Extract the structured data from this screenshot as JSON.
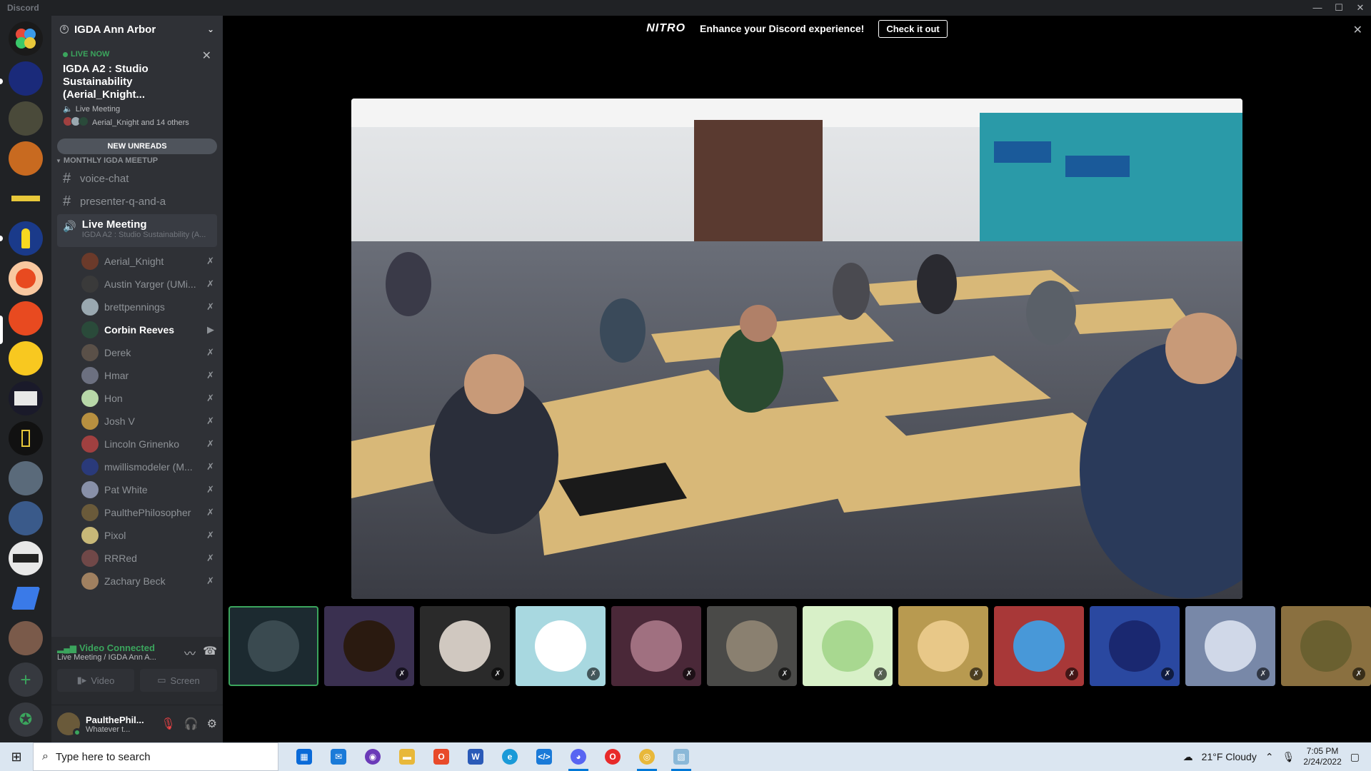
{
  "window": {
    "title": "Discord",
    "controls": [
      "—",
      "☐",
      "✕"
    ]
  },
  "nitro_banner": {
    "logo": "NITRO",
    "message": "Enhance your Discord experience!",
    "cta": "Check it out",
    "close": "✕"
  },
  "server": {
    "name": "IGDA Ann Arbor",
    "chevron": "⌄"
  },
  "live": {
    "badge": "LIVE NOW",
    "close": "✕",
    "title": "IGDA A2 : Studio Sustainability (Aerial_Knight...",
    "channel": "Live Meeting",
    "participants": "Aerial_Knight and 14 others"
  },
  "new_unreads": "NEW UNREADS",
  "category": "MONTHLY IGDA MEETUP",
  "channels": [
    {
      "name": "voice-chat"
    },
    {
      "name": "presenter-q-and-a"
    }
  ],
  "voice_channel": {
    "name": "Live Meeting",
    "sub": "IGDA A2 : Studio Sustainability (A..."
  },
  "voice_users": [
    {
      "name": "Aerial_Knight",
      "icon": "✗",
      "color": "#6b3a2a"
    },
    {
      "name": "Austin Yarger (UMi...",
      "icon": "✗",
      "color": "#3a3a3a"
    },
    {
      "name": "brettpennings",
      "icon": "✗",
      "color": "#9aa8b0"
    },
    {
      "name": "Corbin Reeves",
      "icon": "▶",
      "color": "#2a4a3a",
      "active": true
    },
    {
      "name": "Derek",
      "icon": "✗",
      "color": "#5a5048"
    },
    {
      "name": "Hmar",
      "icon": "✗",
      "color": "#6c7080"
    },
    {
      "name": "Hon",
      "icon": "✗",
      "color": "#b8d8a8"
    },
    {
      "name": "Josh V",
      "icon": "✗",
      "color": "#b89040"
    },
    {
      "name": "Lincoln Grinenko",
      "icon": "✗",
      "color": "#a04040"
    },
    {
      "name": "mwillismodeler (M...",
      "icon": "✗",
      "color": "#2a3a7a"
    },
    {
      "name": "Pat White",
      "icon": "✗",
      "color": "#8890a8"
    },
    {
      "name": "PaulthePhilosopher",
      "icon": "✗",
      "color": "#6a5a3a"
    },
    {
      "name": "Pixol",
      "icon": "✗",
      "color": "#c8b878"
    },
    {
      "name": "RRRed",
      "icon": "✗",
      "color": "#704848"
    },
    {
      "name": "Zachary Beck",
      "icon": "✗",
      "color": "#a08060"
    }
  ],
  "rtc": {
    "status": "Video Connected",
    "location": "Live Meeting / IGDA Ann A...",
    "video_label": "Video",
    "screen_label": "Screen"
  },
  "user": {
    "name": "PaulthePhil...",
    "status": "Whatever t..."
  },
  "tiles": [
    {
      "color": "#1c2a30",
      "avatar": "#3a4a50",
      "selected": true
    },
    {
      "color": "#3a3050",
      "avatar": "#2a1a10"
    },
    {
      "color": "#2a2a2a",
      "avatar": "#d0c8c0"
    },
    {
      "color": "#a8d8e0",
      "avatar": "#ffffff"
    },
    {
      "color": "#4a2838",
      "avatar": "#a07080"
    },
    {
      "color": "#4a4a48",
      "avatar": "#8a8070"
    },
    {
      "color": "#d8f0c8",
      "avatar": "#a8d890"
    },
    {
      "color": "#b89a50",
      "avatar": "#e8c888"
    },
    {
      "color": "#a83838",
      "avatar": "#4898d8"
    },
    {
      "color": "#2a48a0",
      "avatar": "#1a2870"
    },
    {
      "color": "#7888a8",
      "avatar": "#d0d8e8"
    },
    {
      "color": "#8a7040",
      "avatar": "#6a6030"
    }
  ],
  "taskbar": {
    "search_placeholder": "Type here to search",
    "weather": "21°F  Cloudy",
    "time": "7:05 PM",
    "date": "2/24/2022"
  }
}
